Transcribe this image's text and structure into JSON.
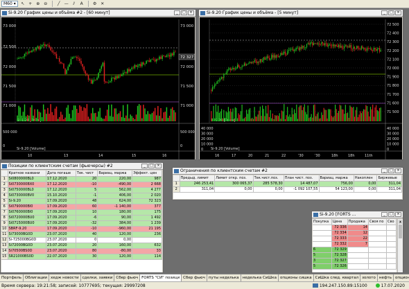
{
  "toolbar": {
    "interval": "M60"
  },
  "win1": {
    "title": "Si-9.20 График цены и объёма #2 - [60 минут]",
    "price_label": "Si-9.20 [Price]",
    "vol_label": "Si-9.20 [Volume]",
    "yticks": [
      "73 000",
      "72 500",
      "72 000",
      "71 500",
      "71 000"
    ],
    "current": "72 327",
    "vticks": [
      "500 000",
      "0"
    ],
    "vticks_right": [
      "500 000",
      "0"
    ],
    "xticks": [
      "10",
      "13",
      "14",
      "15",
      "16"
    ]
  },
  "win2": {
    "title": "Si-9.20 График цены и объёма - [5 минут]",
    "price_label": "Si-9.20 [Price]",
    "vol_label": "Si-9.20 [Volume]",
    "yticks": [
      "72 500",
      "72 400",
      "72 300",
      "72 200",
      "72 100",
      "72 000",
      "71 900",
      "71 800",
      "71 700",
      "71 600",
      "71 500"
    ],
    "vticks": [
      "40 000",
      "30 000",
      "20 000",
      "10 000",
      "0"
    ],
    "xticks": [
      "16",
      "17",
      "20",
      "21",
      "22",
      "'30",
      "'30",
      "18h",
      "18h",
      "11th"
    ]
  },
  "pos": {
    "title": "Позиции по клиентским счетам (фьючерсы) #2",
    "headers": [
      "Краткое названи",
      "Дата погаше",
      "Тек. чист",
      "Вариац. маржа",
      "Эффект. цен"
    ],
    "rows": [
      [
        "1",
        "Si0800000BL0",
        "17.12.2020",
        "20",
        "220,00",
        "987"
      ],
      [
        "2",
        "Si0730000BX0",
        "17.12.2020",
        "-10",
        "-490,00",
        "2 668"
      ],
      [
        "3",
        "Si0750000BL0",
        "17.12.2020",
        "5",
        "562,00",
        "4 277"
      ],
      [
        "4",
        "Si0730000BV0",
        "15.10.2020",
        "-1",
        "406,00",
        "2 020"
      ],
      [
        "5",
        "Si-9.20",
        "17.09.2020",
        "48",
        "624,00",
        "72 323"
      ],
      [
        "6",
        "Si0790000BI0",
        "17.09.2020",
        "60",
        "-1 140,00",
        "377"
      ],
      [
        "7",
        "Si0760000BI0",
        "17.09.2020",
        "10",
        "180,00",
        "175"
      ],
      [
        "8",
        "Si0720000BU0",
        "17.09.2020",
        "-6",
        "90,00",
        "1 492"
      ],
      [
        "9",
        "Si0715000BU0",
        "17.09.2020",
        "-32",
        "384,00",
        "1 239"
      ],
      [
        "10",
        "SBRF-9.20",
        "17.09.2020",
        "-10",
        "-960,00",
        "21 195"
      ],
      [
        "11",
        "Si73000BG0D",
        "23.07.2020",
        "40",
        "120,00",
        "236"
      ],
      [
        "12",
        "Si-725000BG0D",
        "23.07.2020",
        "0",
        "0,00",
        ""
      ],
      [
        "13",
        "Si72000BG0D",
        "23.07.2020",
        "20",
        "160,00",
        "632"
      ],
      [
        "14",
        "Si70500BS0D",
        "23.07.2020",
        "80",
        "-80,00",
        "33"
      ],
      [
        "15",
        "SR21000BS0D",
        "22.07.2020",
        "30",
        "120,00",
        "114"
      ]
    ]
  },
  "limits": {
    "title": "Ограничения по клиентским счетам #2",
    "headers": [
      "Предыд. лимит",
      "Лимит откр. поз.",
      "Тек.чист.поз.",
      "План чист. поз.",
      "Вариац. маржа",
      "Накоплен",
      "Биржевые"
    ],
    "rows": [
      [
        "1",
        "246 253,41",
        "300 065,37",
        "285 578,30",
        "14 487,07",
        "756,00",
        "0,00",
        "311,04"
      ],
      [
        "2",
        "311,04",
        "0,00",
        "0,00",
        "-1 092 107,55",
        "54 123,00",
        "0,00",
        "311,04"
      ]
    ]
  },
  "book": {
    "title": "Si-9.20 [FORTS ...",
    "headers": [
      "Покупка",
      "Цена",
      "Продажа",
      "Своя по",
      "Сво"
    ],
    "sell": [
      [
        "",
        "72 336",
        "14"
      ],
      [
        "",
        "72 334",
        "12"
      ],
      [
        "",
        "72 333",
        "22"
      ],
      [
        "",
        "72 332",
        "7"
      ]
    ],
    "buy": [
      [
        "6",
        "72 329",
        ""
      ],
      [
        "5",
        "72 328",
        ""
      ],
      [
        "3",
        "72 327",
        ""
      ],
      [
        "5",
        "72 326",
        ""
      ]
    ]
  },
  "tabs": [
    "Портфель",
    "Облигации",
    "хедж новости",
    "сделки, заявки",
    "Сбер фьюч",
    "FORTS \"СИ\" позици",
    "Сбер фьюч",
    "путы неделька",
    "неделька СиШка",
    "опционы сишка",
    "СиШка след. квартал",
    "золото",
    "нефть",
    "опционы ртс",
    "анализ"
  ],
  "status": {
    "left": "Время сервера: 19:21:58; записей: 10777695; текущая: 29997208",
    "ip": "194.247.150.89:15100",
    "date": "17.07.2020"
  },
  "colors": {
    "pos_green": "#b5e7a8",
    "pos_red": "#f4a6a6",
    "sell": "#f08a8a",
    "buy": "#7fcf6a"
  }
}
